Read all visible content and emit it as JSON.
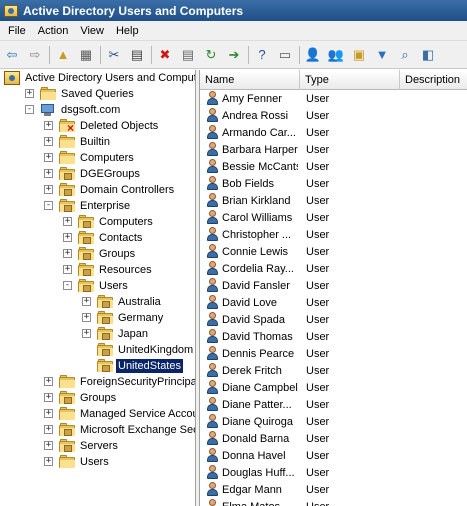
{
  "window": {
    "title": "Active Directory Users and Computers"
  },
  "menu": [
    "File",
    "Action",
    "View",
    "Help"
  ],
  "toolbar": {
    "buttons": [
      {
        "name": "back-arrow-icon",
        "glyph": "⇦",
        "color": "#2a6fc0"
      },
      {
        "name": "forward-arrow-icon",
        "glyph": "⇨",
        "color": "#8a8a8a"
      },
      {
        "sep": true
      },
      {
        "name": "up-folder-icon",
        "glyph": "▲",
        "color": "#c99a20"
      },
      {
        "name": "show-hide-tree-icon",
        "glyph": "▦",
        "color": "#5a5a5a"
      },
      {
        "sep": true
      },
      {
        "name": "cut-icon",
        "glyph": "✂",
        "color": "#2a4f8a"
      },
      {
        "name": "copy-icon",
        "glyph": "▤",
        "color": "#444444"
      },
      {
        "sep": true
      },
      {
        "name": "delete-icon",
        "glyph": "✖",
        "color": "#d01818"
      },
      {
        "name": "properties-icon",
        "glyph": "▤",
        "color": "#6a6a6a"
      },
      {
        "name": "refresh-icon",
        "glyph": "↻",
        "color": "#2a8a2a"
      },
      {
        "name": "export-list-icon",
        "glyph": "➔",
        "color": "#2a8a2a"
      },
      {
        "sep": true
      },
      {
        "name": "help-icon",
        "glyph": "?",
        "color": "#1f4fa0"
      },
      {
        "name": "view-icon",
        "glyph": "▭",
        "color": "#5a5a5a"
      },
      {
        "sep": true
      },
      {
        "name": "new-user-icon",
        "glyph": "👤",
        "color": "#3a6ea5"
      },
      {
        "name": "new-group-icon",
        "glyph": "👥",
        "color": "#3a6ea5"
      },
      {
        "name": "new-ou-icon",
        "glyph": "▣",
        "color": "#c99a20"
      },
      {
        "name": "filter-icon",
        "glyph": "▼",
        "color": "#2a6fc0"
      },
      {
        "name": "find-icon",
        "glyph": "⌕",
        "color": "#2a6fc0"
      },
      {
        "name": "add-to-group-icon",
        "glyph": "◧",
        "color": "#3a6ea5"
      }
    ]
  },
  "tree": [
    {
      "label": "Active Directory Users and Comput",
      "depth": 0,
      "expander": "",
      "icon": "root"
    },
    {
      "label": "Saved Queries",
      "depth": 1,
      "expander": "+",
      "icon": "folder"
    },
    {
      "label": "dsgsoft.com",
      "depth": 1,
      "expander": "−",
      "icon": "domain"
    },
    {
      "label": "Deleted Objects",
      "depth": 2,
      "expander": "+",
      "icon": "deleted"
    },
    {
      "label": "Builtin",
      "depth": 2,
      "expander": "+",
      "icon": "folder"
    },
    {
      "label": "Computers",
      "depth": 2,
      "expander": "+",
      "icon": "folder"
    },
    {
      "label": "DGEGroups",
      "depth": 2,
      "expander": "+",
      "icon": "ou"
    },
    {
      "label": "Domain Controllers",
      "depth": 2,
      "expander": "+",
      "icon": "ou"
    },
    {
      "label": "Enterprise",
      "depth": 2,
      "expander": "−",
      "icon": "ou"
    },
    {
      "label": "Computers",
      "depth": 3,
      "expander": "+",
      "icon": "ou"
    },
    {
      "label": "Contacts",
      "depth": 3,
      "expander": "+",
      "icon": "ou"
    },
    {
      "label": "Groups",
      "depth": 3,
      "expander": "+",
      "icon": "ou"
    },
    {
      "label": "Resources",
      "depth": 3,
      "expander": "+",
      "icon": "ou"
    },
    {
      "label": "Users",
      "depth": 3,
      "expander": "−",
      "icon": "ou"
    },
    {
      "label": "Australia",
      "depth": 4,
      "expander": "+",
      "icon": "ou"
    },
    {
      "label": "Germany",
      "depth": 4,
      "expander": "+",
      "icon": "ou"
    },
    {
      "label": "Japan",
      "depth": 4,
      "expander": "+",
      "icon": "ou"
    },
    {
      "label": "UnitedKingdom",
      "depth": 4,
      "expander": "",
      "icon": "ou"
    },
    {
      "label": "UnitedStates",
      "depth": 4,
      "expander": "",
      "icon": "ou",
      "selected": true
    },
    {
      "label": "ForeignSecurityPrincipals",
      "depth": 2,
      "expander": "+",
      "icon": "folder"
    },
    {
      "label": "Groups",
      "depth": 2,
      "expander": "+",
      "icon": "ou"
    },
    {
      "label": "Managed Service Accounts",
      "depth": 2,
      "expander": "+",
      "icon": "folder"
    },
    {
      "label": "Microsoft Exchange Securit",
      "depth": 2,
      "expander": "+",
      "icon": "ou"
    },
    {
      "label": "Servers",
      "depth": 2,
      "expander": "+",
      "icon": "ou"
    },
    {
      "label": "Users",
      "depth": 2,
      "expander": "+",
      "icon": "folder"
    }
  ],
  "list": {
    "columns": [
      "Name",
      "Type",
      "Description"
    ],
    "rows": [
      {
        "name": "Amy Fenner",
        "type": "User"
      },
      {
        "name": "Andrea Rossi",
        "type": "User"
      },
      {
        "name": "Armando Car...",
        "type": "User"
      },
      {
        "name": "Barbara Harper",
        "type": "User"
      },
      {
        "name": "Bessie McCants",
        "type": "User"
      },
      {
        "name": "Bob Fields",
        "type": "User"
      },
      {
        "name": "Brian Kirkland",
        "type": "User"
      },
      {
        "name": "Carol Williams",
        "type": "User"
      },
      {
        "name": "Christopher ...",
        "type": "User"
      },
      {
        "name": "Connie Lewis",
        "type": "User"
      },
      {
        "name": "Cordelia Ray...",
        "type": "User"
      },
      {
        "name": "David Fansler",
        "type": "User"
      },
      {
        "name": "David Love",
        "type": "User"
      },
      {
        "name": "David Spada",
        "type": "User"
      },
      {
        "name": "David Thomas",
        "type": "User"
      },
      {
        "name": "Dennis Pearce",
        "type": "User"
      },
      {
        "name": "Derek Fritch",
        "type": "User"
      },
      {
        "name": "Diane Campbell",
        "type": "User"
      },
      {
        "name": "Diane Patter...",
        "type": "User"
      },
      {
        "name": "Diane Quiroga",
        "type": "User"
      },
      {
        "name": "Donald Barna",
        "type": "User"
      },
      {
        "name": "Donna Havel",
        "type": "User"
      },
      {
        "name": "Douglas Huff...",
        "type": "User"
      },
      {
        "name": "Edgar Mann",
        "type": "User"
      },
      {
        "name": "Elma Matos",
        "type": "User"
      }
    ]
  }
}
